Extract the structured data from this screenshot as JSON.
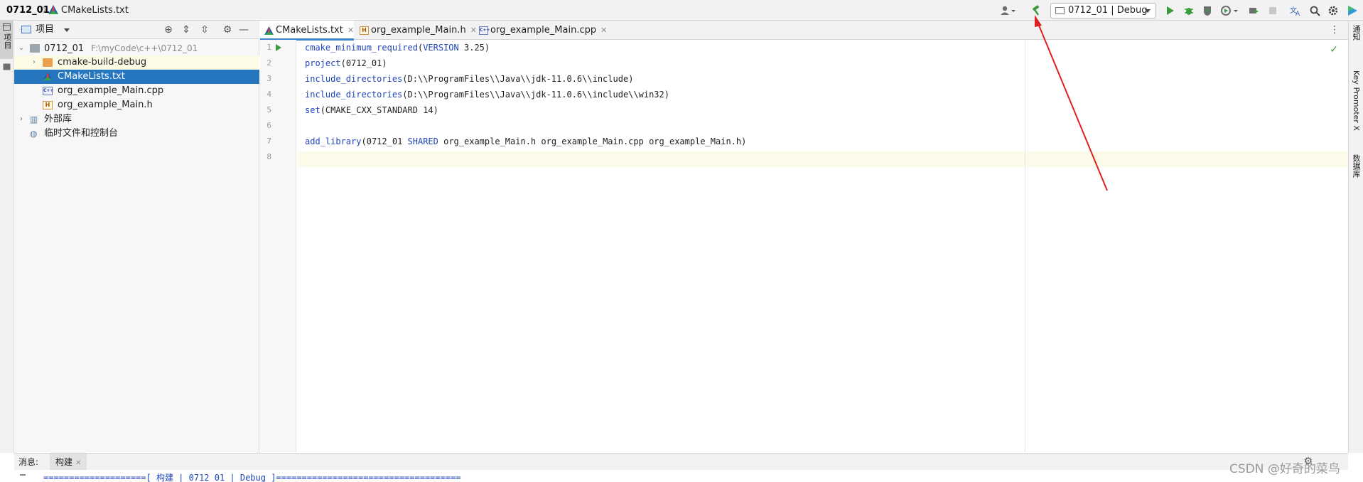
{
  "navbar": {
    "project": "0712_01",
    "separator": "〉",
    "file": "CMakeLists.txt",
    "run_config": "0712_01 | Debug"
  },
  "left_stripe": {
    "project_tool": "项目"
  },
  "right_stripe": {
    "notifications": "通知",
    "key_promoter": "Key Promoter X",
    "database": "数据库"
  },
  "project_panel": {
    "title": "项目",
    "tree": [
      {
        "name": "0712_01",
        "hint": "F:\\myCode\\c++\\0712_01"
      },
      {
        "name": "cmake-build-debug"
      },
      {
        "name": "CMakeLists.txt"
      },
      {
        "name": "org_example_Main.cpp"
      },
      {
        "name": "org_example_Main.h"
      },
      {
        "name": "外部库"
      },
      {
        "name": "临时文件和控制台"
      }
    ]
  },
  "editor": {
    "tabs": [
      {
        "label": "CMakeLists.txt",
        "active": true
      },
      {
        "label": "org_example_Main.h",
        "active": false
      },
      {
        "label": "org_example_Main.cpp",
        "active": false
      }
    ],
    "line_numbers": [
      "1",
      "2",
      "3",
      "4",
      "5",
      "6",
      "7",
      "8"
    ],
    "code": [
      {
        "fn": "cmake_minimum_required",
        "open": "(",
        "kw": "VERSION",
        "rest": " 3.25",
        "close": ")"
      },
      {
        "fn": "project",
        "open": "(",
        "kw": "",
        "rest": "0712_01",
        "close": ")"
      },
      {
        "fn": "include_directories",
        "open": "(",
        "kw": "",
        "rest": "D:\\\\ProgramFiles\\\\Java\\\\jdk-11.0.6\\\\include",
        "close": ")"
      },
      {
        "fn": "include_directories",
        "open": "(",
        "kw": "",
        "rest": "D:\\\\ProgramFiles\\\\Java\\\\jdk-11.0.6\\\\include\\\\win32",
        "close": ")"
      },
      {
        "fn": "set",
        "open": "(",
        "kw": "",
        "rest": "CMAKE_CXX_STANDARD 14",
        "close": ")"
      },
      {
        "fn": "",
        "open": "",
        "kw": "",
        "rest": "",
        "close": ""
      },
      {
        "fn": "add_library",
        "open": "(",
        "kw": "",
        "rest": "0712_01 ",
        "kw2": "SHARED",
        "rest2": " org_example_Main.h org_example_Main.cpp org_example_Main.h",
        "close": ")"
      },
      {
        "fn": "",
        "open": "",
        "kw": "",
        "rest": "",
        "close": ""
      }
    ]
  },
  "bottom": {
    "messages_label": "消息:",
    "build_tab": "构建",
    "output_line": "====================[ 构建 | 0712_01 | Debug ]===================================="
  },
  "watermark": "CSDN @好奇的菜鸟",
  "colors": {
    "accent": "#2675bf",
    "keyword": "#1f45b8",
    "run_green": "#3b9b3b",
    "annotation": "#e02020"
  },
  "icons": [
    "user-icon",
    "build-hammer-icon",
    "run-icon",
    "debug-icon",
    "coverage-icon",
    "profile-icon",
    "attach-icon",
    "stop-icon",
    "translate-icon",
    "search-icon",
    "settings-icon",
    "jetbrains-icon"
  ]
}
